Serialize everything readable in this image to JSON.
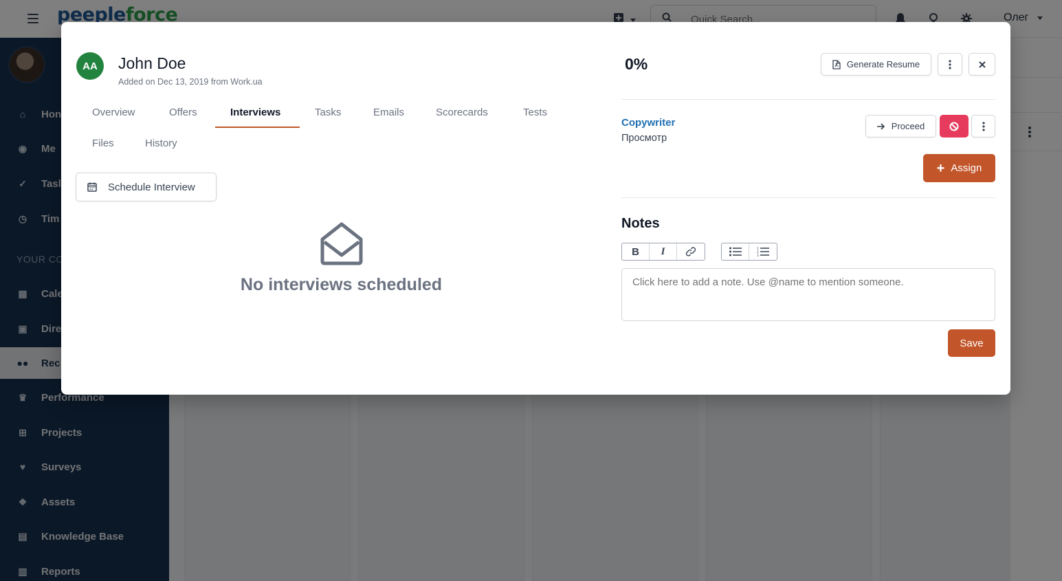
{
  "app": {
    "logo_part1": "peeple",
    "logo_part2": "force",
    "search_placeholder": "Quick Search...",
    "user_name": "Олег",
    "accent_color": "#c2562a"
  },
  "sidebar": {
    "section_label": "YOUR CO",
    "items": [
      {
        "label": "Hon",
        "icon": "home-icon"
      },
      {
        "label": "Me",
        "icon": "user-circle-icon"
      },
      {
        "label": "Tasl",
        "icon": "check-circle-icon"
      },
      {
        "label": "Tim",
        "icon": "clock-icon"
      },
      {
        "label": "Cale",
        "icon": "calendar-icon"
      },
      {
        "label": "Dire",
        "icon": "directory-icon"
      },
      {
        "label": "Rec",
        "icon": "users-icon"
      },
      {
        "label": "Performance",
        "icon": "trophy-icon"
      },
      {
        "label": "Projects",
        "icon": "sitemap-icon"
      },
      {
        "label": "Surveys",
        "icon": "heart-icon"
      },
      {
        "label": "Assets",
        "icon": "cubes-icon"
      },
      {
        "label": "Knowledge Base",
        "icon": "book-icon"
      },
      {
        "label": "Reports",
        "icon": "chart-icon"
      }
    ]
  },
  "modal": {
    "avatar_initials": "AA",
    "candidate_name": "John Doe",
    "added_info": "Added on Dec 13, 2019 from Work.ua",
    "tabs": [
      {
        "label": "Overview"
      },
      {
        "label": "Offers"
      },
      {
        "label": "Interviews",
        "active": true
      },
      {
        "label": "Tasks"
      },
      {
        "label": "Emails"
      },
      {
        "label": "Scorecards"
      },
      {
        "label": "Tests"
      },
      {
        "label": "Files"
      },
      {
        "label": "History"
      }
    ],
    "schedule_button": "Schedule Interview",
    "empty_state": "No interviews scheduled",
    "score": "0%",
    "generate_resume": "Generate Resume",
    "job": {
      "title": "Copywriter",
      "stage": "Просмотр",
      "proceed": "Proceed",
      "assign": "Assign"
    },
    "notes": {
      "title": "Notes",
      "placeholder": "Click here to add a note. Use @name to mention someone.",
      "save": "Save"
    }
  }
}
